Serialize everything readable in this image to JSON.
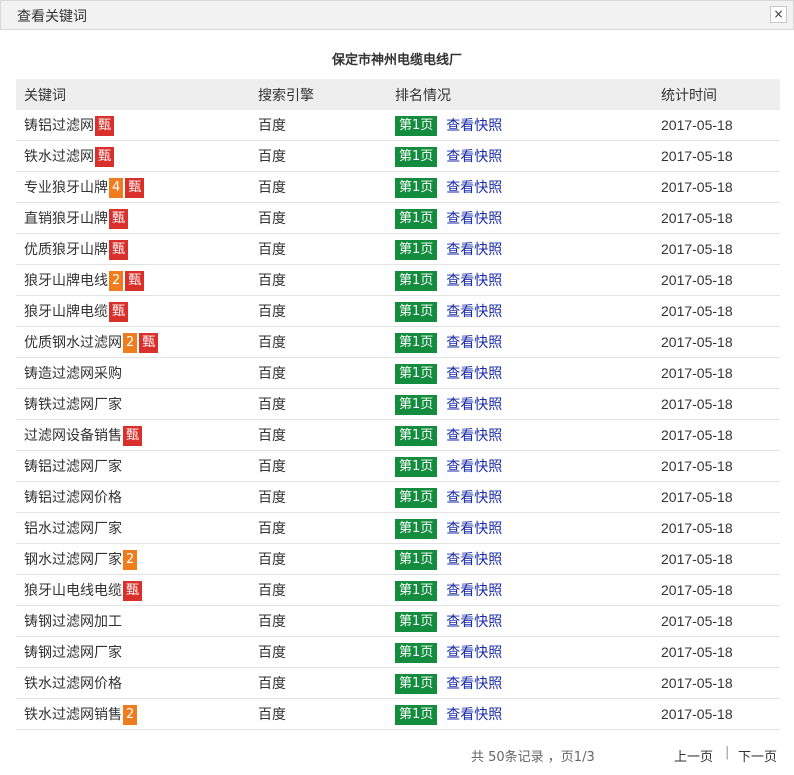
{
  "dialog": {
    "title": "查看关键词",
    "close_label": "×",
    "company": "保定市神州电缆电线厂"
  },
  "table": {
    "headers": [
      "关键词",
      "搜索引擎",
      "排名情况",
      "统计时间"
    ],
    "rank_label": "第1页",
    "snapshot_label": "查看快照",
    "rows": [
      {
        "keyword": "铸铝过滤网",
        "count": "",
        "tag": "甄",
        "engine": "百度",
        "date": "2017-05-18"
      },
      {
        "keyword": "铁水过滤网",
        "count": "",
        "tag": "甄",
        "engine": "百度",
        "date": "2017-05-18"
      },
      {
        "keyword": "专业狼牙山牌",
        "count": "4",
        "tag": "甄",
        "engine": "百度",
        "date": "2017-05-18"
      },
      {
        "keyword": "直销狼牙山牌",
        "count": "",
        "tag": "甄",
        "engine": "百度",
        "date": "2017-05-18"
      },
      {
        "keyword": "优质狼牙山牌",
        "count": "",
        "tag": "甄",
        "engine": "百度",
        "date": "2017-05-18"
      },
      {
        "keyword": "狼牙山牌电线",
        "count": "2",
        "tag": "甄",
        "engine": "百度",
        "date": "2017-05-18"
      },
      {
        "keyword": "狼牙山牌电缆",
        "count": "",
        "tag": "甄",
        "engine": "百度",
        "date": "2017-05-18"
      },
      {
        "keyword": "优质钢水过滤网",
        "count": "2",
        "tag": "甄",
        "engine": "百度",
        "date": "2017-05-18"
      },
      {
        "keyword": "铸造过滤网采购",
        "count": "",
        "tag": "",
        "engine": "百度",
        "date": "2017-05-18"
      },
      {
        "keyword": "铸铁过滤网厂家",
        "count": "",
        "tag": "",
        "engine": "百度",
        "date": "2017-05-18"
      },
      {
        "keyword": "过滤网设备销售",
        "count": "",
        "tag": "甄",
        "engine": "百度",
        "date": "2017-05-18"
      },
      {
        "keyword": "铸铝过滤网厂家",
        "count": "",
        "tag": "",
        "engine": "百度",
        "date": "2017-05-18"
      },
      {
        "keyword": "铸铝过滤网价格",
        "count": "",
        "tag": "",
        "engine": "百度",
        "date": "2017-05-18"
      },
      {
        "keyword": "铝水过滤网厂家",
        "count": "",
        "tag": "",
        "engine": "百度",
        "date": "2017-05-18"
      },
      {
        "keyword": "钢水过滤网厂家",
        "count": "2",
        "tag": "",
        "engine": "百度",
        "date": "2017-05-18"
      },
      {
        "keyword": "狼牙山电线电缆",
        "count": "",
        "tag": "甄",
        "engine": "百度",
        "date": "2017-05-18"
      },
      {
        "keyword": "铸钢过滤网加工",
        "count": "",
        "tag": "",
        "engine": "百度",
        "date": "2017-05-18"
      },
      {
        "keyword": "铸钢过滤网厂家",
        "count": "",
        "tag": "",
        "engine": "百度",
        "date": "2017-05-18"
      },
      {
        "keyword": "铁水过滤网价格",
        "count": "",
        "tag": "",
        "engine": "百度",
        "date": "2017-05-18"
      },
      {
        "keyword": "铁水过滤网销售",
        "count": "2",
        "tag": "",
        "engine": "百度",
        "date": "2017-05-18"
      }
    ]
  },
  "pager": {
    "info": "共 50条记录 ，页1/3",
    "prev": "上一页",
    "separator": "|",
    "next": "下一页"
  },
  "colors": {
    "rank_green": "#138d3d",
    "tag_red": "#d9302b",
    "count_orange": "#f07d1d",
    "link_blue": "#1a2ba8"
  }
}
